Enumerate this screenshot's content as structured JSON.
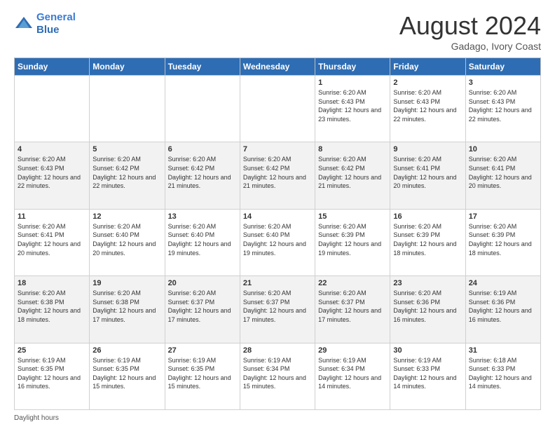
{
  "logo": {
    "line1": "General",
    "line2": "Blue"
  },
  "header": {
    "month_year": "August 2024",
    "location": "Gadago, Ivory Coast"
  },
  "days_of_week": [
    "Sunday",
    "Monday",
    "Tuesday",
    "Wednesday",
    "Thursday",
    "Friday",
    "Saturday"
  ],
  "weeks": [
    [
      {
        "day": "",
        "info": ""
      },
      {
        "day": "",
        "info": ""
      },
      {
        "day": "",
        "info": ""
      },
      {
        "day": "",
        "info": ""
      },
      {
        "day": "1",
        "info": "Sunrise: 6:20 AM\nSunset: 6:43 PM\nDaylight: 12 hours and 23 minutes."
      },
      {
        "day": "2",
        "info": "Sunrise: 6:20 AM\nSunset: 6:43 PM\nDaylight: 12 hours and 22 minutes."
      },
      {
        "day": "3",
        "info": "Sunrise: 6:20 AM\nSunset: 6:43 PM\nDaylight: 12 hours and 22 minutes."
      }
    ],
    [
      {
        "day": "4",
        "info": "Sunrise: 6:20 AM\nSunset: 6:43 PM\nDaylight: 12 hours and 22 minutes."
      },
      {
        "day": "5",
        "info": "Sunrise: 6:20 AM\nSunset: 6:42 PM\nDaylight: 12 hours and 22 minutes."
      },
      {
        "day": "6",
        "info": "Sunrise: 6:20 AM\nSunset: 6:42 PM\nDaylight: 12 hours and 21 minutes."
      },
      {
        "day": "7",
        "info": "Sunrise: 6:20 AM\nSunset: 6:42 PM\nDaylight: 12 hours and 21 minutes."
      },
      {
        "day": "8",
        "info": "Sunrise: 6:20 AM\nSunset: 6:42 PM\nDaylight: 12 hours and 21 minutes."
      },
      {
        "day": "9",
        "info": "Sunrise: 6:20 AM\nSunset: 6:41 PM\nDaylight: 12 hours and 20 minutes."
      },
      {
        "day": "10",
        "info": "Sunrise: 6:20 AM\nSunset: 6:41 PM\nDaylight: 12 hours and 20 minutes."
      }
    ],
    [
      {
        "day": "11",
        "info": "Sunrise: 6:20 AM\nSunset: 6:41 PM\nDaylight: 12 hours and 20 minutes."
      },
      {
        "day": "12",
        "info": "Sunrise: 6:20 AM\nSunset: 6:40 PM\nDaylight: 12 hours and 20 minutes."
      },
      {
        "day": "13",
        "info": "Sunrise: 6:20 AM\nSunset: 6:40 PM\nDaylight: 12 hours and 19 minutes."
      },
      {
        "day": "14",
        "info": "Sunrise: 6:20 AM\nSunset: 6:40 PM\nDaylight: 12 hours and 19 minutes."
      },
      {
        "day": "15",
        "info": "Sunrise: 6:20 AM\nSunset: 6:39 PM\nDaylight: 12 hours and 19 minutes."
      },
      {
        "day": "16",
        "info": "Sunrise: 6:20 AM\nSunset: 6:39 PM\nDaylight: 12 hours and 18 minutes."
      },
      {
        "day": "17",
        "info": "Sunrise: 6:20 AM\nSunset: 6:39 PM\nDaylight: 12 hours and 18 minutes."
      }
    ],
    [
      {
        "day": "18",
        "info": "Sunrise: 6:20 AM\nSunset: 6:38 PM\nDaylight: 12 hours and 18 minutes."
      },
      {
        "day": "19",
        "info": "Sunrise: 6:20 AM\nSunset: 6:38 PM\nDaylight: 12 hours and 17 minutes."
      },
      {
        "day": "20",
        "info": "Sunrise: 6:20 AM\nSunset: 6:37 PM\nDaylight: 12 hours and 17 minutes."
      },
      {
        "day": "21",
        "info": "Sunrise: 6:20 AM\nSunset: 6:37 PM\nDaylight: 12 hours and 17 minutes."
      },
      {
        "day": "22",
        "info": "Sunrise: 6:20 AM\nSunset: 6:37 PM\nDaylight: 12 hours and 17 minutes."
      },
      {
        "day": "23",
        "info": "Sunrise: 6:20 AM\nSunset: 6:36 PM\nDaylight: 12 hours and 16 minutes."
      },
      {
        "day": "24",
        "info": "Sunrise: 6:19 AM\nSunset: 6:36 PM\nDaylight: 12 hours and 16 minutes."
      }
    ],
    [
      {
        "day": "25",
        "info": "Sunrise: 6:19 AM\nSunset: 6:35 PM\nDaylight: 12 hours and 16 minutes."
      },
      {
        "day": "26",
        "info": "Sunrise: 6:19 AM\nSunset: 6:35 PM\nDaylight: 12 hours and 15 minutes."
      },
      {
        "day": "27",
        "info": "Sunrise: 6:19 AM\nSunset: 6:35 PM\nDaylight: 12 hours and 15 minutes."
      },
      {
        "day": "28",
        "info": "Sunrise: 6:19 AM\nSunset: 6:34 PM\nDaylight: 12 hours and 15 minutes."
      },
      {
        "day": "29",
        "info": "Sunrise: 6:19 AM\nSunset: 6:34 PM\nDaylight: 12 hours and 14 minutes."
      },
      {
        "day": "30",
        "info": "Sunrise: 6:19 AM\nSunset: 6:33 PM\nDaylight: 12 hours and 14 minutes."
      },
      {
        "day": "31",
        "info": "Sunrise: 6:18 AM\nSunset: 6:33 PM\nDaylight: 12 hours and 14 minutes."
      }
    ]
  ],
  "footer": {
    "daylight_label": "Daylight hours"
  }
}
